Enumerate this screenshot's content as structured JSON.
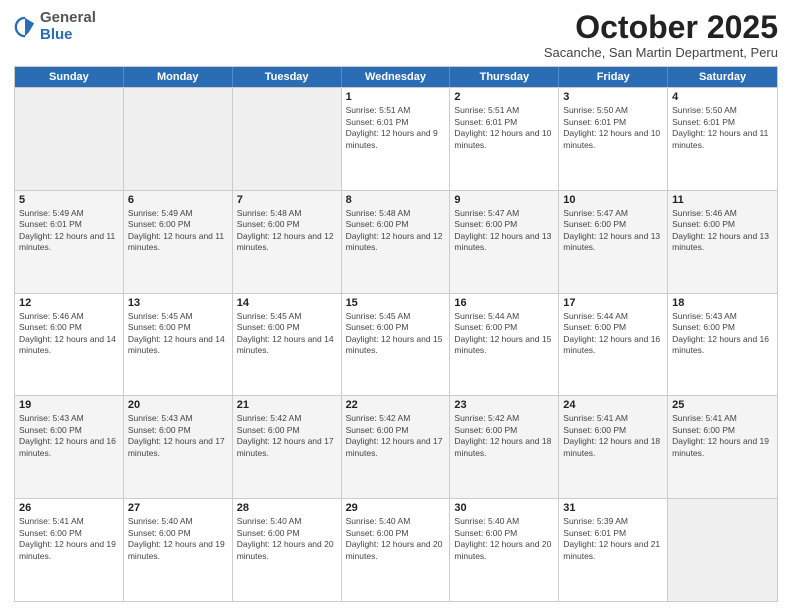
{
  "header": {
    "logo": {
      "general": "General",
      "blue": "Blue"
    },
    "title": "October 2025",
    "location": "Sacanche, San Martin Department, Peru"
  },
  "calendar": {
    "days": [
      "Sunday",
      "Monday",
      "Tuesday",
      "Wednesday",
      "Thursday",
      "Friday",
      "Saturday"
    ],
    "weeks": [
      [
        {
          "day": "",
          "empty": true
        },
        {
          "day": "",
          "empty": true
        },
        {
          "day": "",
          "empty": true
        },
        {
          "day": "1",
          "sunrise": "Sunrise: 5:51 AM",
          "sunset": "Sunset: 6:01 PM",
          "daylight": "Daylight: 12 hours and 9 minutes."
        },
        {
          "day": "2",
          "sunrise": "Sunrise: 5:51 AM",
          "sunset": "Sunset: 6:01 PM",
          "daylight": "Daylight: 12 hours and 10 minutes."
        },
        {
          "day": "3",
          "sunrise": "Sunrise: 5:50 AM",
          "sunset": "Sunset: 6:01 PM",
          "daylight": "Daylight: 12 hours and 10 minutes."
        },
        {
          "day": "4",
          "sunrise": "Sunrise: 5:50 AM",
          "sunset": "Sunset: 6:01 PM",
          "daylight": "Daylight: 12 hours and 11 minutes."
        }
      ],
      [
        {
          "day": "5",
          "sunrise": "Sunrise: 5:49 AM",
          "sunset": "Sunset: 6:01 PM",
          "daylight": "Daylight: 12 hours and 11 minutes."
        },
        {
          "day": "6",
          "sunrise": "Sunrise: 5:49 AM",
          "sunset": "Sunset: 6:00 PM",
          "daylight": "Daylight: 12 hours and 11 minutes."
        },
        {
          "day": "7",
          "sunrise": "Sunrise: 5:48 AM",
          "sunset": "Sunset: 6:00 PM",
          "daylight": "Daylight: 12 hours and 12 minutes."
        },
        {
          "day": "8",
          "sunrise": "Sunrise: 5:48 AM",
          "sunset": "Sunset: 6:00 PM",
          "daylight": "Daylight: 12 hours and 12 minutes."
        },
        {
          "day": "9",
          "sunrise": "Sunrise: 5:47 AM",
          "sunset": "Sunset: 6:00 PM",
          "daylight": "Daylight: 12 hours and 13 minutes."
        },
        {
          "day": "10",
          "sunrise": "Sunrise: 5:47 AM",
          "sunset": "Sunset: 6:00 PM",
          "daylight": "Daylight: 12 hours and 13 minutes."
        },
        {
          "day": "11",
          "sunrise": "Sunrise: 5:46 AM",
          "sunset": "Sunset: 6:00 PM",
          "daylight": "Daylight: 12 hours and 13 minutes."
        }
      ],
      [
        {
          "day": "12",
          "sunrise": "Sunrise: 5:46 AM",
          "sunset": "Sunset: 6:00 PM",
          "daylight": "Daylight: 12 hours and 14 minutes."
        },
        {
          "day": "13",
          "sunrise": "Sunrise: 5:45 AM",
          "sunset": "Sunset: 6:00 PM",
          "daylight": "Daylight: 12 hours and 14 minutes."
        },
        {
          "day": "14",
          "sunrise": "Sunrise: 5:45 AM",
          "sunset": "Sunset: 6:00 PM",
          "daylight": "Daylight: 12 hours and 14 minutes."
        },
        {
          "day": "15",
          "sunrise": "Sunrise: 5:45 AM",
          "sunset": "Sunset: 6:00 PM",
          "daylight": "Daylight: 12 hours and 15 minutes."
        },
        {
          "day": "16",
          "sunrise": "Sunrise: 5:44 AM",
          "sunset": "Sunset: 6:00 PM",
          "daylight": "Daylight: 12 hours and 15 minutes."
        },
        {
          "day": "17",
          "sunrise": "Sunrise: 5:44 AM",
          "sunset": "Sunset: 6:00 PM",
          "daylight": "Daylight: 12 hours and 16 minutes."
        },
        {
          "day": "18",
          "sunrise": "Sunrise: 5:43 AM",
          "sunset": "Sunset: 6:00 PM",
          "daylight": "Daylight: 12 hours and 16 minutes."
        }
      ],
      [
        {
          "day": "19",
          "sunrise": "Sunrise: 5:43 AM",
          "sunset": "Sunset: 6:00 PM",
          "daylight": "Daylight: 12 hours and 16 minutes."
        },
        {
          "day": "20",
          "sunrise": "Sunrise: 5:43 AM",
          "sunset": "Sunset: 6:00 PM",
          "daylight": "Daylight: 12 hours and 17 minutes."
        },
        {
          "day": "21",
          "sunrise": "Sunrise: 5:42 AM",
          "sunset": "Sunset: 6:00 PM",
          "daylight": "Daylight: 12 hours and 17 minutes."
        },
        {
          "day": "22",
          "sunrise": "Sunrise: 5:42 AM",
          "sunset": "Sunset: 6:00 PM",
          "daylight": "Daylight: 12 hours and 17 minutes."
        },
        {
          "day": "23",
          "sunrise": "Sunrise: 5:42 AM",
          "sunset": "Sunset: 6:00 PM",
          "daylight": "Daylight: 12 hours and 18 minutes."
        },
        {
          "day": "24",
          "sunrise": "Sunrise: 5:41 AM",
          "sunset": "Sunset: 6:00 PM",
          "daylight": "Daylight: 12 hours and 18 minutes."
        },
        {
          "day": "25",
          "sunrise": "Sunrise: 5:41 AM",
          "sunset": "Sunset: 6:00 PM",
          "daylight": "Daylight: 12 hours and 19 minutes."
        }
      ],
      [
        {
          "day": "26",
          "sunrise": "Sunrise: 5:41 AM",
          "sunset": "Sunset: 6:00 PM",
          "daylight": "Daylight: 12 hours and 19 minutes."
        },
        {
          "day": "27",
          "sunrise": "Sunrise: 5:40 AM",
          "sunset": "Sunset: 6:00 PM",
          "daylight": "Daylight: 12 hours and 19 minutes."
        },
        {
          "day": "28",
          "sunrise": "Sunrise: 5:40 AM",
          "sunset": "Sunset: 6:00 PM",
          "daylight": "Daylight: 12 hours and 20 minutes."
        },
        {
          "day": "29",
          "sunrise": "Sunrise: 5:40 AM",
          "sunset": "Sunset: 6:00 PM",
          "daylight": "Daylight: 12 hours and 20 minutes."
        },
        {
          "day": "30",
          "sunrise": "Sunrise: 5:40 AM",
          "sunset": "Sunset: 6:00 PM",
          "daylight": "Daylight: 12 hours and 20 minutes."
        },
        {
          "day": "31",
          "sunrise": "Sunrise: 5:39 AM",
          "sunset": "Sunset: 6:01 PM",
          "daylight": "Daylight: 12 hours and 21 minutes."
        },
        {
          "day": "",
          "empty": true
        }
      ]
    ]
  }
}
